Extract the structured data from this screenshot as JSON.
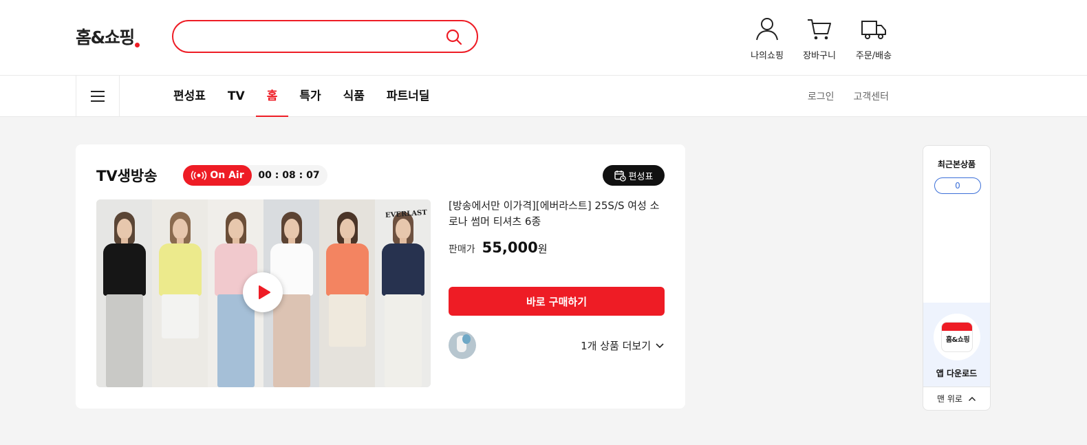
{
  "header": {
    "logo": "홈&쇼핑",
    "search": {
      "value": "",
      "placeholder": ""
    },
    "utilities": [
      {
        "label": "나의쇼핑",
        "icon": "user-icon"
      },
      {
        "label": "장바구니",
        "icon": "cart-icon"
      },
      {
        "label": "주문/배송",
        "icon": "truck-icon"
      }
    ]
  },
  "nav": {
    "tabs": [
      "편성표",
      "TV",
      "홈",
      "특가",
      "식품",
      "파트너딜"
    ],
    "active_tab": "홈",
    "right_links": [
      "로그인",
      "고객센터"
    ]
  },
  "live": {
    "title": "TV생방송",
    "on_air_label": "On Air",
    "timer": "00 : 08 : 07",
    "schedule_label": "편성표",
    "product_name": "[방송에서만 이가격][에버라스트] 25S/S 여성 소로나 썸머 티셔츠 6종",
    "price_label": "판매가",
    "price_value": "55,000",
    "price_unit": "원",
    "buy_label": "바로 구매하기",
    "more_label": "1개 상품 더보기",
    "brand_mark": "EVERLAST"
  },
  "sidebar": {
    "recent_title": "최근본상품",
    "recent_count": "0",
    "app_logo_text": "홈&쇼핑",
    "app_download_label": "앱 다운로드",
    "back_to_top_label": "맨 위로"
  },
  "colors": {
    "accent": "#ee1c25",
    "link_blue": "#3b6fd8",
    "background": "#f4f4f4"
  }
}
